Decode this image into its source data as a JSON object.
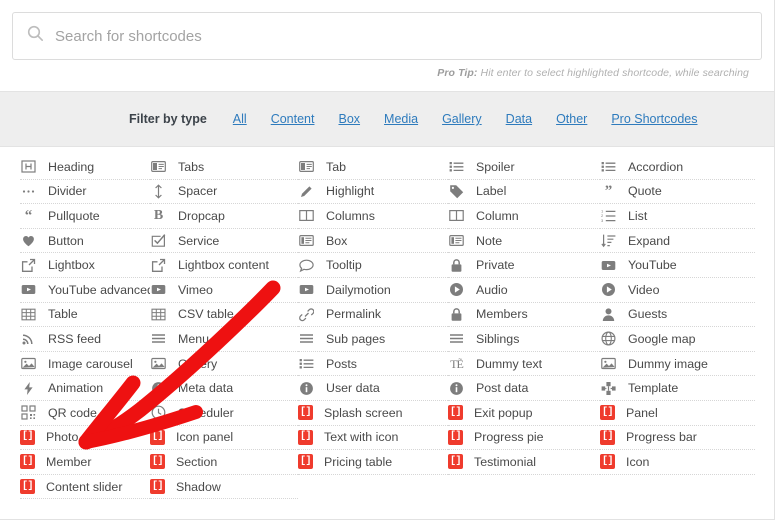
{
  "search": {
    "placeholder": "Search for shortcodes",
    "value": "",
    "icon": "search-icon"
  },
  "protip": {
    "label": "Pro Tip:",
    "text": " Hit enter to select highlighted shortcode, while searching"
  },
  "filter": {
    "label": "Filter by type",
    "options": [
      "All",
      "Content",
      "Box",
      "Media",
      "Gallery",
      "Data",
      "Other",
      "Pro Shortcodes"
    ]
  },
  "colors": {
    "pro_badge": "#ef3b2d",
    "link": "#2e7bbd",
    "filter_bar_bg": "#eeeeee",
    "annotation_arrow": "#ee1111",
    "text": "#4a4a4a"
  },
  "annotation": {
    "type": "hand-drawn-arrow",
    "points_to": "QR code",
    "color": "#ee1111"
  },
  "columns": [
    {
      "items": [
        {
          "label": "Heading",
          "icon": "heading-icon",
          "pro": false
        },
        {
          "label": "Divider",
          "icon": "divider-dots-icon",
          "pro": false
        },
        {
          "label": "Pullquote",
          "icon": "pullquote-icon",
          "pro": false
        },
        {
          "label": "Button",
          "icon": "heart-icon",
          "pro": false
        },
        {
          "label": "Lightbox",
          "icon": "external-link-icon",
          "pro": false
        },
        {
          "label": "YouTube advanced",
          "icon": "video-box-icon",
          "pro": false
        },
        {
          "label": "Table",
          "icon": "table-icon",
          "pro": false
        },
        {
          "label": "RSS feed",
          "icon": "rss-icon",
          "pro": false
        },
        {
          "label": "Image carousel",
          "icon": "image-icon",
          "pro": false
        },
        {
          "label": "Animation",
          "icon": "bolt-icon",
          "pro": false
        },
        {
          "label": "QR code",
          "icon": "qr-code-icon",
          "pro": false
        },
        {
          "label": "Photo panel",
          "icon": "pro-bracket-icon",
          "pro": true
        },
        {
          "label": "Member",
          "icon": "pro-bracket-icon",
          "pro": true
        },
        {
          "label": "Content slider",
          "icon": "pro-bracket-icon",
          "pro": true
        }
      ]
    },
    {
      "items": [
        {
          "label": "Tabs",
          "icon": "tabs-icon",
          "pro": false
        },
        {
          "label": "Spacer",
          "icon": "spacer-arrow-icon",
          "pro": false
        },
        {
          "label": "Dropcap",
          "icon": "bold-b-icon",
          "pro": false
        },
        {
          "label": "Service",
          "icon": "check-square-icon",
          "pro": false
        },
        {
          "label": "Lightbox content",
          "icon": "external-link-icon",
          "pro": false
        },
        {
          "label": "Vimeo",
          "icon": "video-box-icon",
          "pro": false
        },
        {
          "label": "CSV table",
          "icon": "table-icon",
          "pro": false
        },
        {
          "label": "Menu",
          "icon": "menu-icon",
          "pro": false
        },
        {
          "label": "Gallery",
          "icon": "image-icon",
          "pro": false
        },
        {
          "label": "Meta data",
          "icon": "info-icon",
          "pro": false
        },
        {
          "label": "Scheduler",
          "icon": "clock-icon",
          "pro": false
        },
        {
          "label": "Icon panel",
          "icon": "pro-bracket-icon",
          "pro": true
        },
        {
          "label": "Section",
          "icon": "pro-bracket-icon",
          "pro": true
        },
        {
          "label": "Shadow",
          "icon": "pro-bracket-icon",
          "pro": true
        }
      ]
    },
    {
      "items": [
        {
          "label": "Tab",
          "icon": "tabs-icon",
          "pro": false
        },
        {
          "label": "Highlight",
          "icon": "pencil-icon",
          "pro": false
        },
        {
          "label": "Columns",
          "icon": "columns-icon",
          "pro": false
        },
        {
          "label": "Box",
          "icon": "box-icon",
          "pro": false
        },
        {
          "label": "Tooltip",
          "icon": "speech-bubble-icon",
          "pro": false
        },
        {
          "label": "Dailymotion",
          "icon": "video-box-icon",
          "pro": false
        },
        {
          "label": "Permalink",
          "icon": "link-icon",
          "pro": false
        },
        {
          "label": "Sub pages",
          "icon": "menu-icon",
          "pro": false
        },
        {
          "label": "Posts",
          "icon": "list-icon",
          "pro": false
        },
        {
          "label": "User data",
          "icon": "info-icon",
          "pro": false
        },
        {
          "label": "Splash screen",
          "icon": "pro-bracket-icon",
          "pro": true
        },
        {
          "label": "Text with icon",
          "icon": "pro-bracket-icon",
          "pro": true
        },
        {
          "label": "Pricing table",
          "icon": "pro-bracket-icon",
          "pro": true
        }
      ]
    },
    {
      "items": [
        {
          "label": "Spoiler",
          "icon": "list-icon",
          "pro": false
        },
        {
          "label": "Label",
          "icon": "tag-icon",
          "pro": false
        },
        {
          "label": "Column",
          "icon": "columns-icon",
          "pro": false
        },
        {
          "label": "Note",
          "icon": "box-icon",
          "pro": false
        },
        {
          "label": "Private",
          "icon": "lock-icon",
          "pro": false
        },
        {
          "label": "Audio",
          "icon": "play-circle-icon",
          "pro": false
        },
        {
          "label": "Members",
          "icon": "lock-icon",
          "pro": false
        },
        {
          "label": "Siblings",
          "icon": "menu-icon",
          "pro": false
        },
        {
          "label": "Dummy text",
          "icon": "text-type-icon",
          "pro": false
        },
        {
          "label": "Post data",
          "icon": "info-icon",
          "pro": false
        },
        {
          "label": "Exit popup",
          "icon": "pro-bracket-icon",
          "pro": true
        },
        {
          "label": "Progress pie",
          "icon": "pro-bracket-icon",
          "pro": true
        },
        {
          "label": "Testimonial",
          "icon": "pro-bracket-icon",
          "pro": true
        }
      ]
    },
    {
      "items": [
        {
          "label": "Accordion",
          "icon": "list-icon",
          "pro": false
        },
        {
          "label": "Quote",
          "icon": "quote-icon",
          "pro": false
        },
        {
          "label": "List",
          "icon": "ordered-list-icon",
          "pro": false
        },
        {
          "label": "Expand",
          "icon": "sort-amount-icon",
          "pro": false
        },
        {
          "label": "YouTube",
          "icon": "video-box-icon",
          "pro": false
        },
        {
          "label": "Video",
          "icon": "play-circle-icon",
          "pro": false
        },
        {
          "label": "Guests",
          "icon": "user-icon",
          "pro": false
        },
        {
          "label": "Google map",
          "icon": "globe-icon",
          "pro": false
        },
        {
          "label": "Dummy image",
          "icon": "image-icon",
          "pro": false
        },
        {
          "label": "Template",
          "icon": "template-icon",
          "pro": false
        },
        {
          "label": "Panel",
          "icon": "pro-bracket-icon",
          "pro": true
        },
        {
          "label": "Progress bar",
          "icon": "pro-bracket-icon",
          "pro": true
        },
        {
          "label": "Icon",
          "icon": "pro-bracket-icon",
          "pro": true
        }
      ]
    }
  ]
}
